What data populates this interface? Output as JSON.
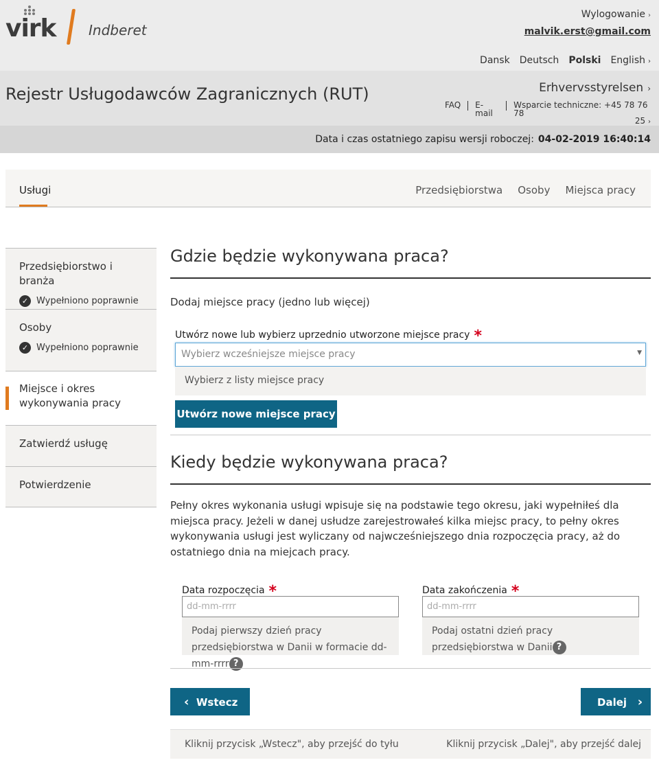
{
  "header": {
    "logo_text": "virk",
    "logo_subtitle": "Indberet",
    "logout_label": "Wylogowanie",
    "user_email": "malvik.erst@gmail.com",
    "languages": [
      "Dansk",
      "Deutsch",
      "Polski",
      "English"
    ],
    "active_language": "Polski"
  },
  "service": {
    "title": "Rejestr Usługodawców Zagranicznych (RUT)",
    "agency": "Erhvervsstyrelsen",
    "faq": "FAQ",
    "email_link": "E-mail",
    "support_line1": "Wsparcie techniczne: +45 78 76 78",
    "support_line2": "25"
  },
  "draft": {
    "label": "Data i czas ostatniego zapisu wersji roboczej:",
    "datetime": "04-02-2019 16:40:14"
  },
  "tabs": {
    "active": "Usługi",
    "others": [
      "Przedsiębiorstwa",
      "Osoby",
      "Miejsca pracy"
    ]
  },
  "sidebar": {
    "items": [
      {
        "label": "Przedsiębiorstwo i branża",
        "status": "Wypełniono poprawnie"
      },
      {
        "label": "Osoby",
        "status": "Wypełniono poprawnie"
      },
      {
        "label": "Miejsce i okres wykonywania pracy",
        "status": ""
      },
      {
        "label": "Zatwierdź usługę",
        "status": ""
      },
      {
        "label": "Potwierdzenie",
        "status": ""
      }
    ]
  },
  "where": {
    "heading": "Gdzie będzie wykonywana praca?",
    "subtitle": "Dodaj miejsce pracy (jedno lub więcej)",
    "field_label": "Utwórz nowe lub wybierz uprzednio utworzone miejsce pracy",
    "required_mark": "*",
    "select_placeholder": "Wybierz wcześniejsze miejsce pracy",
    "dropdown_option": "Wybierz z listy miejsce pracy",
    "create_button": "Utwórz nowe miejsce pracy"
  },
  "when": {
    "heading": "Kiedy będzie wykonywana praca?",
    "description": "Pełny okres wykonania usługi wpisuje się na podstawie tego okresu, jaki wypełniłeś dla miejsca pracy. Jeżeli w danej usłudze zarejestrowałeś kilka miejsc pracy, to pełny okres wykonywania usługi jest wyliczany od najwcześniejszego dnia rozpoczęcia pracy, aż do ostatniego dnia na miejcach pracy.",
    "start_label": "Data rozpoczęcia",
    "start_placeholder": "dd-mm-rrrr",
    "start_help": "Podaj pierwszy dzień pracy przedsiębiorstwa w Danii w formacie dd-mm-rrrr",
    "end_label": "Data zakończenia",
    "end_placeholder": "dd-mm-rrrr",
    "end_help": "Podaj ostatni dzień pracy przedsiębiorstwa w Danii"
  },
  "nav": {
    "back_label": "Wstecz",
    "next_label": "Dalej",
    "back_hint": "Kliknij przycisk „Wstecz\", aby przejść do tyłu",
    "next_hint": "Kliknij przycisk „Dalej\", aby przejść dalej"
  },
  "colors": {
    "accent_orange": "#e07b1f",
    "primary_button": "#0f6585",
    "required_red": "#d4001c"
  }
}
